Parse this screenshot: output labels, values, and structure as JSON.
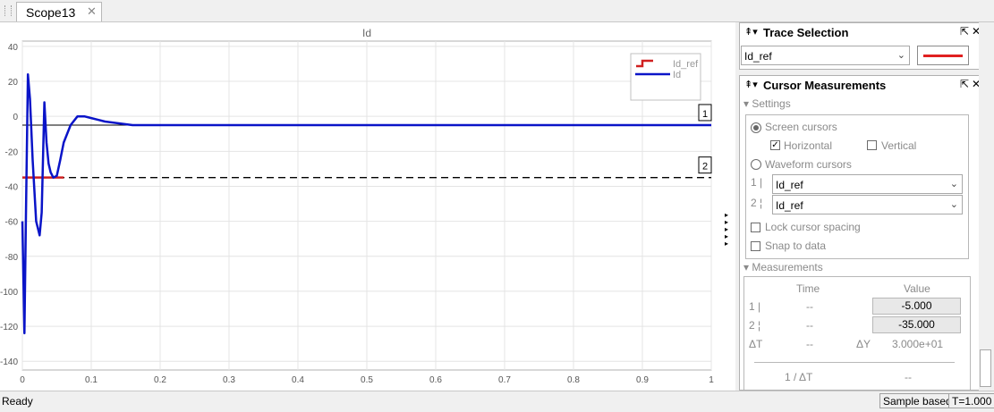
{
  "tab": {
    "title": "Scope13",
    "close": "✕"
  },
  "plot": {
    "title": "Id",
    "yticks": [
      "40",
      "20",
      "0",
      "-20",
      "-40",
      "-60",
      "-80",
      "-100",
      "-120",
      "-140"
    ],
    "xticks": [
      "0",
      "0.1",
      "0.2",
      "0.3",
      "0.4",
      "0.5",
      "0.6",
      "0.7",
      "0.8",
      "0.9",
      "1"
    ],
    "legend": [
      {
        "label": "Id_ref",
        "color": "#d02020"
      },
      {
        "label": "Id",
        "color": "#0a14c8"
      }
    ],
    "cursor1_label": "1",
    "cursor2_label": "2",
    "cursor1_value": -5,
    "cursor2_value": -35,
    "xlim": [
      0,
      1
    ],
    "ylim": [
      -145,
      43
    ]
  },
  "chart_data": {
    "type": "line",
    "title": "Id",
    "xlabel": "",
    "ylabel": "",
    "xlim": [
      0,
      1
    ],
    "ylim": [
      -145,
      43
    ],
    "grid": true,
    "legend_position": "top-right",
    "series": [
      {
        "name": "Id_ref",
        "color": "#d02020",
        "x": [
          0,
          0.06
        ],
        "values": [
          -35,
          -35
        ],
        "step_to": -5
      },
      {
        "name": "Id",
        "color": "#0a14c8",
        "x": [
          0,
          0.003,
          0.005,
          0.008,
          0.011,
          0.015,
          0.02,
          0.025,
          0.028,
          0.032,
          0.035,
          0.038,
          0.041,
          0.045,
          0.05,
          0.055,
          0.06,
          0.07,
          0.08,
          0.09,
          0.1,
          0.11,
          0.12,
          0.14,
          0.16,
          0.18,
          0.2,
          0.3,
          0.4,
          0.5,
          0.6,
          0.7,
          0.8,
          0.9,
          1.0
        ],
        "values": [
          -60,
          -124,
          -60,
          24,
          10,
          -25,
          -60,
          -68,
          -55,
          8,
          -15,
          -27,
          -32,
          -35,
          -34,
          -25,
          -15,
          -5,
          0,
          0,
          -1,
          -2,
          -3,
          -4,
          -5,
          -5,
          -5,
          -5,
          -5,
          -5,
          -5,
          -5,
          -5,
          -5,
          -5
        ]
      }
    ]
  },
  "sidebar": {
    "trace_selection": {
      "title": "Trace Selection",
      "selected": "Id_ref",
      "line_color": "#e02020"
    },
    "cursor_measurements": {
      "title": "Cursor Measurements",
      "settings_label": "Settings",
      "screen_cursors": "Screen cursors",
      "horizontal": "Horizontal",
      "vertical": "Vertical",
      "waveform_cursors": "Waveform cursors",
      "cursor1_label": "1 |",
      "cursor2_label": "2 ¦",
      "cursor1_signal": "Id_ref",
      "cursor2_signal": "Id_ref",
      "lock_spacing": "Lock cursor spacing",
      "snap_to_data": "Snap to data",
      "measurements_label": "Measurements",
      "col_time": "Time",
      "col_value": "Value",
      "row1_label": "1 |",
      "row2_label": "2 ¦",
      "row1_time": "--",
      "row2_time": "--",
      "row1_value": "-5.000",
      "row2_value": "-35.000",
      "dt_label": "ΔT",
      "dt_value": "--",
      "dy_label": "ΔY",
      "dy_value": "3.000e+01",
      "inv_dt_label": "1 / ΔT",
      "inv_dt_value": "--"
    }
  },
  "status": {
    "ready": "Ready",
    "mode": "Sample based",
    "time": "T=1.000"
  }
}
